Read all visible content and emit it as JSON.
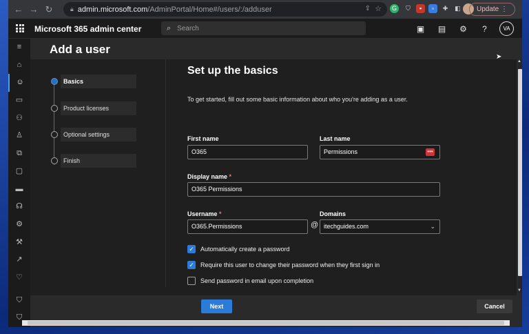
{
  "browser": {
    "url_host": "admin.microsoft.com",
    "url_path": "/AdminPortal/Home#/users/:/adduser",
    "update_label": "Update",
    "menu_glyph": "⋮"
  },
  "header": {
    "app_title": "Microsoft 365 admin center",
    "search_placeholder": "Search",
    "avatar_initials": "VA"
  },
  "page": {
    "title": "Add a user",
    "steps": [
      {
        "label": "Basics",
        "current": true
      },
      {
        "label": "Product licenses",
        "current": false
      },
      {
        "label": "Optional settings",
        "current": false
      },
      {
        "label": "Finish",
        "current": false
      }
    ],
    "section_title": "Set up the basics",
    "intro": "To get started, fill out some basic information about who you're adding as a user.",
    "first_name": {
      "label": "First name",
      "value": "O365"
    },
    "last_name": {
      "label": "Last name",
      "value": "Permissions"
    },
    "display_name": {
      "label": "Display name",
      "required": "*",
      "value": "O365 Permissions"
    },
    "username": {
      "label": "Username",
      "required": "*",
      "value": "O365.Permissions"
    },
    "at_sign": "@",
    "domains": {
      "label": "Domains",
      "value": "itechguides.com"
    },
    "checkboxes": [
      {
        "label": "Automatically create a password",
        "checked": true
      },
      {
        "label": "Require this user to change their password when they first sign in",
        "checked": true
      },
      {
        "label": "Send password in email upon completion",
        "checked": false
      }
    ],
    "next_label": "Next",
    "cancel_label": "Cancel"
  },
  "colors": {
    "accent": "#2b7bd8",
    "background": "#1f1f1f",
    "required": "#e87979"
  },
  "icons": [
    "back-arrow-icon",
    "forward-arrow-icon",
    "reload-icon",
    "lock-icon",
    "share-icon",
    "star-icon",
    "waffle-icon",
    "search-icon",
    "terminal-icon",
    "document-icon",
    "gear-icon",
    "help-icon",
    "home-icon",
    "user-icon",
    "device-icon",
    "groups-icon",
    "roles-icon",
    "resources-icon",
    "billing-icon",
    "payment-icon",
    "support-icon",
    "settings-icon",
    "setup-icon",
    "reports-icon",
    "health-icon",
    "security-icon",
    "compliance-icon",
    "chevron-down-icon",
    "check-icon"
  ]
}
